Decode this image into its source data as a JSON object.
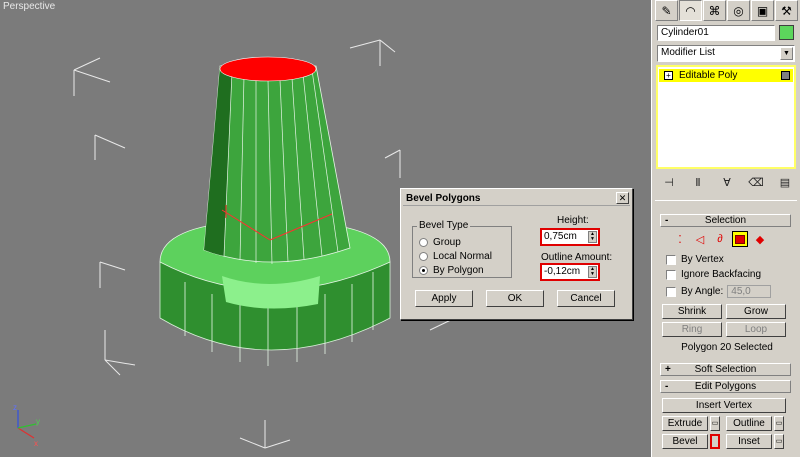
{
  "viewport": {
    "label": "Perspective",
    "object_color": "#3fae3f",
    "top_cap_color": "#ff0000"
  },
  "panel": {
    "tabs": [
      "create-tab",
      "modify-tab",
      "hierarchy-tab",
      "motion-tab",
      "display-tab",
      "utilities-tab"
    ],
    "object_name": "Cylinder01",
    "object_color": "#5cd65c",
    "modifier_list": "Modifier List",
    "stack_item": "Editable Poly",
    "selection_rollout": "Selection",
    "by_vertex": "By Vertex",
    "ignore_backfacing": "Ignore Backfacing",
    "by_angle": "By Angle:",
    "by_angle_value": "45,0",
    "shrink": "Shrink",
    "grow": "Grow",
    "ring": "Ring",
    "loop": "Loop",
    "status": "Polygon 20 Selected",
    "soft_selection": "Soft Selection",
    "edit_polygons": "Edit Polygons",
    "insert_vertex": "Insert Vertex",
    "extrude": "Extrude",
    "outline": "Outline",
    "bevel": "Bevel",
    "inset": "Inset",
    "minus": "-",
    "plus": "+"
  },
  "dialog": {
    "title": "Bevel Polygons",
    "close": "✕",
    "bevel_type_label": "Bevel Type",
    "options": [
      "Group",
      "Local Normal",
      "By Polygon"
    ],
    "selected_option": "By Polygon",
    "height_label": "Height:",
    "height_value": "0,75cm",
    "outline_label": "Outline Amount:",
    "outline_value": "-0,12cm",
    "apply": "Apply",
    "ok": "OK",
    "cancel": "Cancel"
  }
}
